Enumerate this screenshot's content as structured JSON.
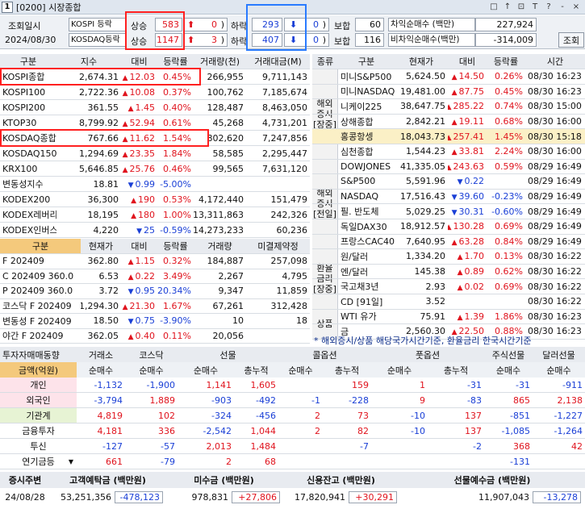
{
  "window": {
    "badge": "1",
    "title": "[0200] 시장종합",
    "icons": [
      "□",
      "↑",
      "⊡",
      "T",
      "?",
      "-",
      "×"
    ]
  },
  "top": {
    "date_label": "조회일시",
    "date": "2024/08/30",
    "kospi_label": "KOSPI 등락",
    "kosdaq_label": "KOSDAQ등락",
    "up_label": "상승",
    "down_label": "하락",
    "flat_label": "보합",
    "kospi": {
      "up": "583",
      "up_limit": "0",
      "down": "293",
      "down_limit": "0",
      "flat": "60"
    },
    "kosdaq": {
      "up": "1147",
      "up_limit": "3",
      "down": "407",
      "down_limit": "0",
      "flat": "116"
    },
    "arb_label": "차익순매수 (백만)",
    "arb": "227,924",
    "nonarb_label": "비차익순매수(백만)",
    "nonarb": "-314,009",
    "query_button": "조회"
  },
  "domestic": {
    "headers": [
      "구분",
      "지수",
      "대비",
      "등락률",
      "거래량(천)",
      "거래대금(M)"
    ],
    "rows": [
      {
        "name": "KOSPI종합",
        "value": "2,674.31",
        "dir": "up",
        "chg": "12.03",
        "rate": "0.45%",
        "vol": "266,955",
        "amt": "9,711,143"
      },
      {
        "name": "KOSPI100",
        "value": "2,722.36",
        "dir": "up",
        "chg": "10.08",
        "rate": "0.37%",
        "vol": "100,762",
        "amt": "7,185,674"
      },
      {
        "name": "KOSPI200",
        "value": "361.55",
        "dir": "up",
        "chg": "1.45",
        "rate": "0.40%",
        "vol": "128,487",
        "amt": "8,463,050"
      },
      {
        "name": "KTOP30",
        "value": "8,799.92",
        "dir": "up",
        "chg": "52.94",
        "rate": "0.61%",
        "vol": "45,268",
        "amt": "4,731,201"
      },
      {
        "name": "KOSDAQ종합",
        "value": "767.66",
        "dir": "up",
        "chg": "11.62",
        "rate": "1.54%",
        "vol": "802,620",
        "amt": "7,247,856"
      },
      {
        "name": "KOSDAQ150",
        "value": "1,294.69",
        "dir": "up",
        "chg": "23.35",
        "rate": "1.84%",
        "vol": "58,585",
        "amt": "2,295,447"
      },
      {
        "name": "KRX100",
        "value": "5,646.85",
        "dir": "up",
        "chg": "25.76",
        "rate": "0.46%",
        "vol": "99,565",
        "amt": "7,631,120"
      },
      {
        "name": "변동성지수",
        "value": "18.81",
        "dir": "down",
        "chg": "0.99",
        "rate": "-5.00%",
        "vol": "",
        "amt": ""
      },
      {
        "name": "KODEX200",
        "value": "36,300",
        "dir": "up",
        "chg": "190",
        "rate": "0.53%",
        "vol": "4,172,440",
        "amt": "151,479"
      },
      {
        "name": "KODEX레버리지",
        "value": "18,195",
        "dir": "up",
        "chg": "180",
        "rate": "1.00%",
        "vol": "13,311,863",
        "amt": "242,326"
      },
      {
        "name": "KODEX인버스",
        "value": "4,220",
        "dir": "down",
        "chg": "25",
        "rate": "-0.59%",
        "vol": "14,273,233",
        "amt": "60,236"
      }
    ]
  },
  "futures": {
    "headers": [
      "구분",
      "현재가",
      "대비",
      "등락률",
      "거래량",
      "미결제약정"
    ],
    "rows": [
      {
        "name": "F 202409",
        "value": "362.80",
        "dir": "up",
        "chg": "1.15",
        "rate": "0.32%",
        "vol": "184,887",
        "oi": "257,098"
      },
      {
        "name": "C 202409 360.0",
        "value": "6.53",
        "dir": "up",
        "chg": "0.22",
        "rate": "3.49%",
        "vol": "2,267",
        "oi": "4,795"
      },
      {
        "name": "P 202409 360.0",
        "value": "3.72",
        "dir": "down",
        "chg": "0.95",
        "rate": "20.34%",
        "vol": "9,347",
        "oi": "11,859"
      },
      {
        "name": "코스닥 F 202409",
        "value": "1,294.30",
        "dir": "up",
        "chg": "21.30",
        "rate": "1.67%",
        "vol": "67,261",
        "oi": "312,428"
      },
      {
        "name": "변동성 F 202409",
        "value": "18.50",
        "dir": "down",
        "chg": "0.75",
        "rate": "-3.90%",
        "vol": "10",
        "oi": "18"
      },
      {
        "name": "야간 F 202409",
        "value": "362.05",
        "dir": "up",
        "chg": "0.40",
        "rate": "0.11%",
        "vol": "20,056",
        "oi": ""
      }
    ]
  },
  "overseas": {
    "headers": [
      "종류",
      "구분",
      "현재가",
      "대비",
      "등락률",
      "시간"
    ],
    "groups": [
      {
        "label": "해외\n증시\n[장중]",
        "rows": [
          {
            "name": "미니S&P500",
            "value": "5,624.50",
            "dir": "up",
            "chg": "14.50",
            "rate": "0.26%",
            "time": "08/30 16:23"
          },
          {
            "name": "미니NASDAQ",
            "value": "19,481.00",
            "dir": "up",
            "chg": "87.75",
            "rate": "0.45%",
            "time": "08/30 16:23"
          },
          {
            "name": "니케이225",
            "value": "38,647.75",
            "dir": "up",
            "chg": "285.22",
            "rate": "0.74%",
            "time": "08/30 15:00"
          },
          {
            "name": "상해종합",
            "value": "2,842.21",
            "dir": "up",
            "chg": "19.11",
            "rate": "0.68%",
            "time": "08/30 16:00"
          },
          {
            "name": "홍콩항셍",
            "value": "18,043.73",
            "dir": "up",
            "chg": "257.41",
            "rate": "1.45%",
            "time": "08/30 15:18"
          },
          {
            "name": "심천종합",
            "value": "1,544.23",
            "dir": "up",
            "chg": "33.81",
            "rate": "2.24%",
            "time": "08/30 16:00"
          }
        ]
      },
      {
        "label": "해외\n증시\n[전일]",
        "rows": [
          {
            "name": "DOWJONES",
            "value": "41,335.05",
            "dir": "up",
            "chg": "243.63",
            "rate": "0.59%",
            "time": "08/29 16:49"
          },
          {
            "name": "S&P500",
            "value": "5,591.96",
            "dir": "down",
            "chg": "0.22",
            "rate": "",
            "time": "08/29 16:49"
          },
          {
            "name": "NASDAQ",
            "value": "17,516.43",
            "dir": "down",
            "chg": "39.60",
            "rate": "-0.23%",
            "time": "08/29 16:49"
          },
          {
            "name": "필. 반도체",
            "value": "5,029.25",
            "dir": "down",
            "chg": "30.31",
            "rate": "-0.60%",
            "time": "08/29 16:49"
          },
          {
            "name": "독일DAX30",
            "value": "18,912.57",
            "dir": "up",
            "chg": "130.28",
            "rate": "0.69%",
            "time": "08/29 16:49"
          },
          {
            "name": "프랑스CAC40",
            "value": "7,640.95",
            "dir": "up",
            "chg": "63.28",
            "rate": "0.84%",
            "time": "08/29 16:49"
          }
        ]
      },
      {
        "label": "환율\n금리\n[장중]",
        "rows": [
          {
            "name": "원/달러",
            "value": "1,334.20",
            "dir": "up",
            "chg": "1.70",
            "rate": "0.13%",
            "time": "08/30 16:22"
          },
          {
            "name": "엔/달러",
            "value": "145.38",
            "dir": "up",
            "chg": "0.89",
            "rate": "0.62%",
            "time": "08/30 16:22"
          },
          {
            "name": "국고채3년",
            "value": "2.93",
            "dir": "up",
            "chg": "0.02",
            "rate": "0.69%",
            "time": "08/30 16:22"
          },
          {
            "name": "CD [91일]",
            "value": "3.52",
            "dir": "",
            "chg": "",
            "rate": "",
            "time": "08/30 16:22"
          }
        ]
      },
      {
        "label": "상품",
        "rows": [
          {
            "name": "WTI 유가",
            "value": "75.91",
            "dir": "up",
            "chg": "1.39",
            "rate": "1.86%",
            "time": "08/30 16:23"
          },
          {
            "name": "금",
            "value": "2,560.30",
            "dir": "up",
            "chg": "22.50",
            "rate": "0.88%",
            "time": "08/30 16:23"
          }
        ]
      }
    ],
    "note": "* 해외증시/상품 해당국가시간기준, 환율금리 한국시간기준"
  },
  "investors": {
    "title": "투자자매매동향",
    "group_headers": [
      "거래소",
      "코스닥",
      "선물",
      "콜옵션",
      "풋옵션",
      "주식선물",
      "달러선물"
    ],
    "amount_label": "금액(억원)",
    "sub_headers": [
      "순매수",
      "순매수",
      "순매수",
      "총누적",
      "순매수",
      "총누적",
      "순매수",
      "총누적",
      "순매수",
      "순매수"
    ],
    "rows": [
      {
        "name": "개인",
        "cls": "pink",
        "v": [
          "-1,132",
          "-1,900",
          "1,141",
          "1,605",
          "",
          "159",
          "1",
          "-31",
          "-31",
          "-911"
        ]
      },
      {
        "name": "외국인",
        "cls": "pink",
        "v": [
          "-3,794",
          "1,889",
          "-903",
          "-492",
          "-1",
          "-228",
          "9",
          "-83",
          "865",
          "2,138"
        ]
      },
      {
        "name": "기관계",
        "cls": "green",
        "v": [
          "4,819",
          "102",
          "-324",
          "-456",
          "2",
          "73",
          "-10",
          "137",
          "-851",
          "-1,227"
        ]
      },
      {
        "name": "금융투자",
        "cls": "",
        "v": [
          "4,181",
          "336",
          "-2,542",
          "1,044",
          "2",
          "82",
          "-10",
          "137",
          "-1,085",
          "-1,264"
        ]
      },
      {
        "name": "투신",
        "cls": "",
        "v": [
          "-127",
          "-57",
          "2,013",
          "1,484",
          "",
          "-7",
          "",
          "-2",
          "368",
          "42"
        ]
      },
      {
        "name": "연기금등",
        "cls": "",
        "v": [
          "661",
          "-79",
          "2",
          "68",
          "",
          "",
          "",
          "",
          "-131",
          ""
        ]
      }
    ]
  },
  "bottom": {
    "headers": [
      "증시주변",
      "고객예탁금 (백만원)",
      "미수금 (백만원)",
      "신용잔고 (백만원)",
      "선물예수금 (백만원)"
    ],
    "date": "24/08/28",
    "deposit": "53,251,356",
    "deposit_chg": "-478,123",
    "unpaid": "978,831",
    "unpaid_chg": "+27,806",
    "credit": "17,820,941",
    "credit_chg": "+30,291",
    "futures_dep": "11,907,043",
    "futures_dep_chg": "-13,278"
  },
  "colors": {
    "up": "#e0141e",
    "down": "#1a3fd6",
    "highlight_red": "#ff2020",
    "highlight_blue": "#2a7bff"
  }
}
